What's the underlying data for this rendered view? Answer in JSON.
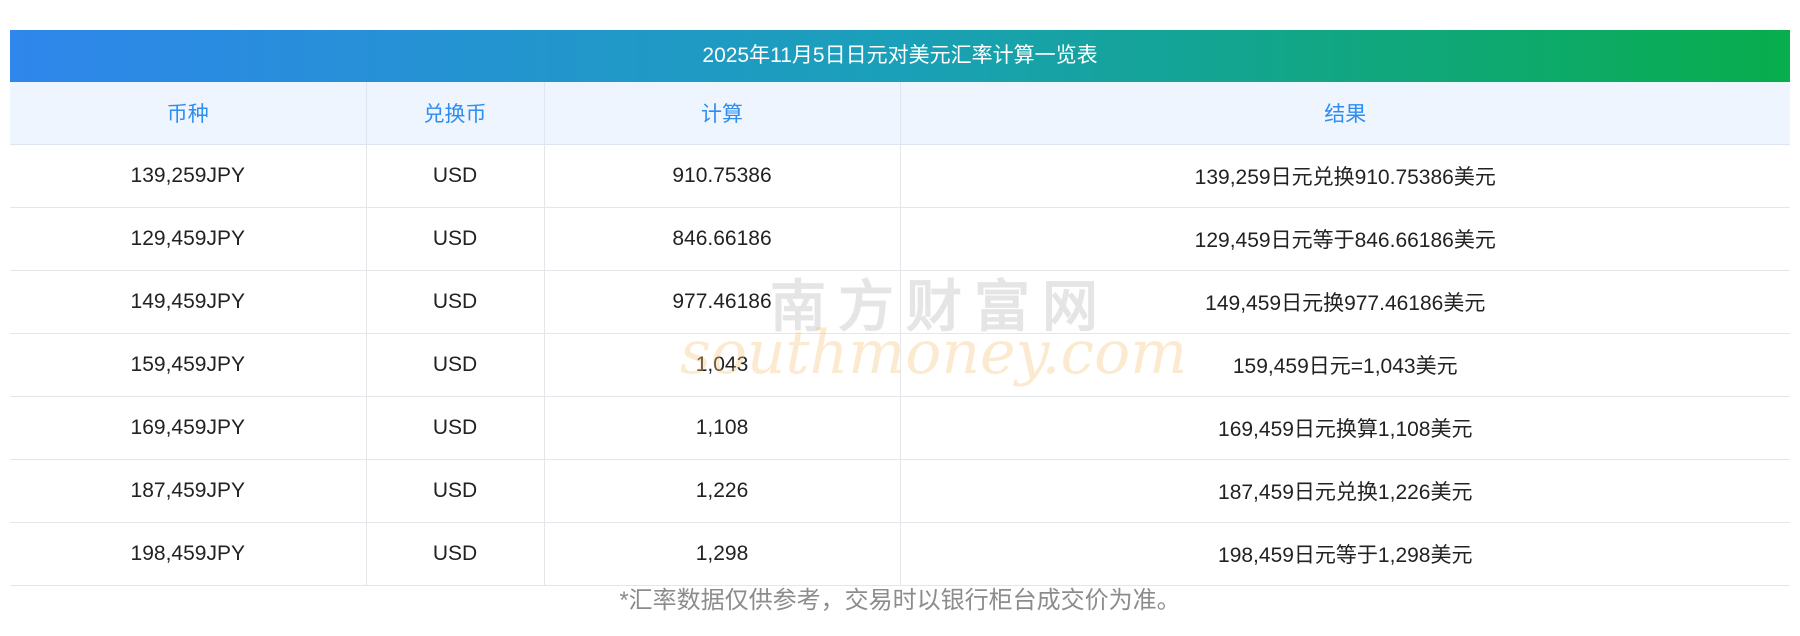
{
  "table": {
    "title": "2025年11月5日日元对美元汇率计算一览表",
    "headers": [
      "币种",
      "兑换币",
      "计算",
      "结果"
    ],
    "rows": [
      [
        "139,259JPY",
        "USD",
        "910.75386",
        "139,259日元兑换910.75386美元"
      ],
      [
        "129,459JPY",
        "USD",
        "846.66186",
        "129,459日元等于846.66186美元"
      ],
      [
        "149,459JPY",
        "USD",
        "977.46186",
        "149,459日元换977.46186美元"
      ],
      [
        "159,459JPY",
        "USD",
        "1,043",
        "159,459日元=1,043美元"
      ],
      [
        "169,459JPY",
        "USD",
        "1,108",
        "169,459日元换算1,108美元"
      ],
      [
        "187,459JPY",
        "USD",
        "1,226",
        "187,459日元兑换1,226美元"
      ],
      [
        "198,459JPY",
        "USD",
        "1,298",
        "198,459日元等于1,298美元"
      ]
    ]
  },
  "footnote": "*汇率数据仅供参考，交易时以银行柜台成交价为准。",
  "watermark": {
    "cn": "南方财富网",
    "en": "southmoney.com"
  },
  "colors": {
    "gradient_start": "#2f86ec",
    "gradient_end": "#08ad4c",
    "header_text": "#2f8df0",
    "header_bg": "#eef5fe"
  }
}
